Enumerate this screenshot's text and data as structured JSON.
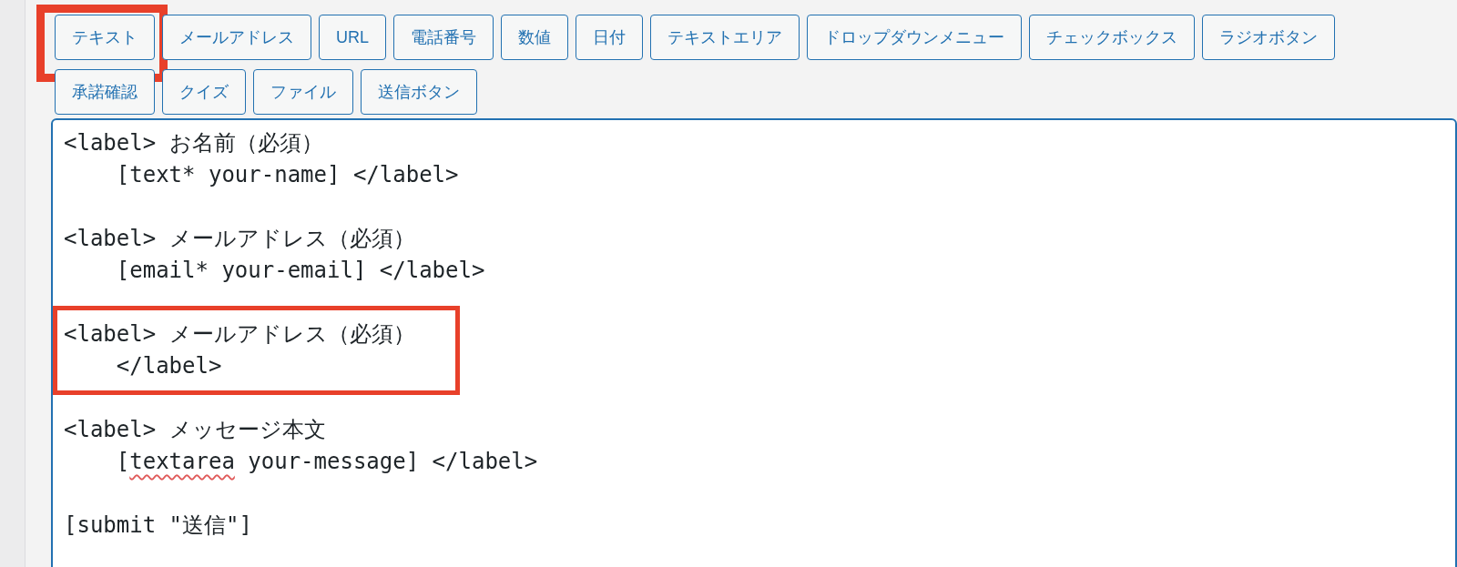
{
  "tag_buttons": [
    {
      "label": "テキスト",
      "highlighted": true
    },
    {
      "label": "メールアドレス",
      "highlighted": false
    },
    {
      "label": "URL",
      "highlighted": false
    },
    {
      "label": "電話番号",
      "highlighted": false
    },
    {
      "label": "数値",
      "highlighted": false
    },
    {
      "label": "日付",
      "highlighted": false
    },
    {
      "label": "テキストエリア",
      "highlighted": false
    },
    {
      "label": "ドロップダウンメニュー",
      "highlighted": false
    },
    {
      "label": "チェックボックス",
      "highlighted": false
    },
    {
      "label": "ラジオボタン",
      "highlighted": false
    },
    {
      "label": "承諾確認",
      "highlighted": false
    },
    {
      "label": "クイズ",
      "highlighted": false
    },
    {
      "label": "ファイル",
      "highlighted": false
    },
    {
      "label": "送信ボタン",
      "highlighted": false
    }
  ],
  "editor": {
    "blocks": [
      {
        "highlighted": false,
        "lines": [
          [
            {
              "text": "<label> お名前（必須）",
              "misspelled": false
            }
          ],
          [
            {
              "text": "    [text* your-name] </label>",
              "misspelled": false
            }
          ]
        ]
      },
      {
        "highlighted": false,
        "lines": [
          [
            {
              "text": "<label> メールアドレス（必須）",
              "misspelled": false
            }
          ],
          [
            {
              "text": "    [email* your-email] </label>",
              "misspelled": false
            }
          ]
        ]
      },
      {
        "highlighted": true,
        "lines": [
          [
            {
              "text": "<label> メールアドレス（必須）",
              "misspelled": false
            }
          ],
          [
            {
              "text": "    </label>",
              "misspelled": false
            }
          ]
        ]
      },
      {
        "highlighted": false,
        "lines": [
          [
            {
              "text": "<label> メッセージ本文",
              "misspelled": false
            }
          ],
          [
            {
              "text": "    [",
              "misspelled": false
            },
            {
              "text": "textarea",
              "misspelled": true
            },
            {
              "text": " your-message] </label>",
              "misspelled": false
            }
          ]
        ]
      },
      {
        "highlighted": false,
        "lines": [
          [
            {
              "text": "[submit \"送信\"]",
              "misspelled": false
            }
          ]
        ]
      }
    ]
  }
}
